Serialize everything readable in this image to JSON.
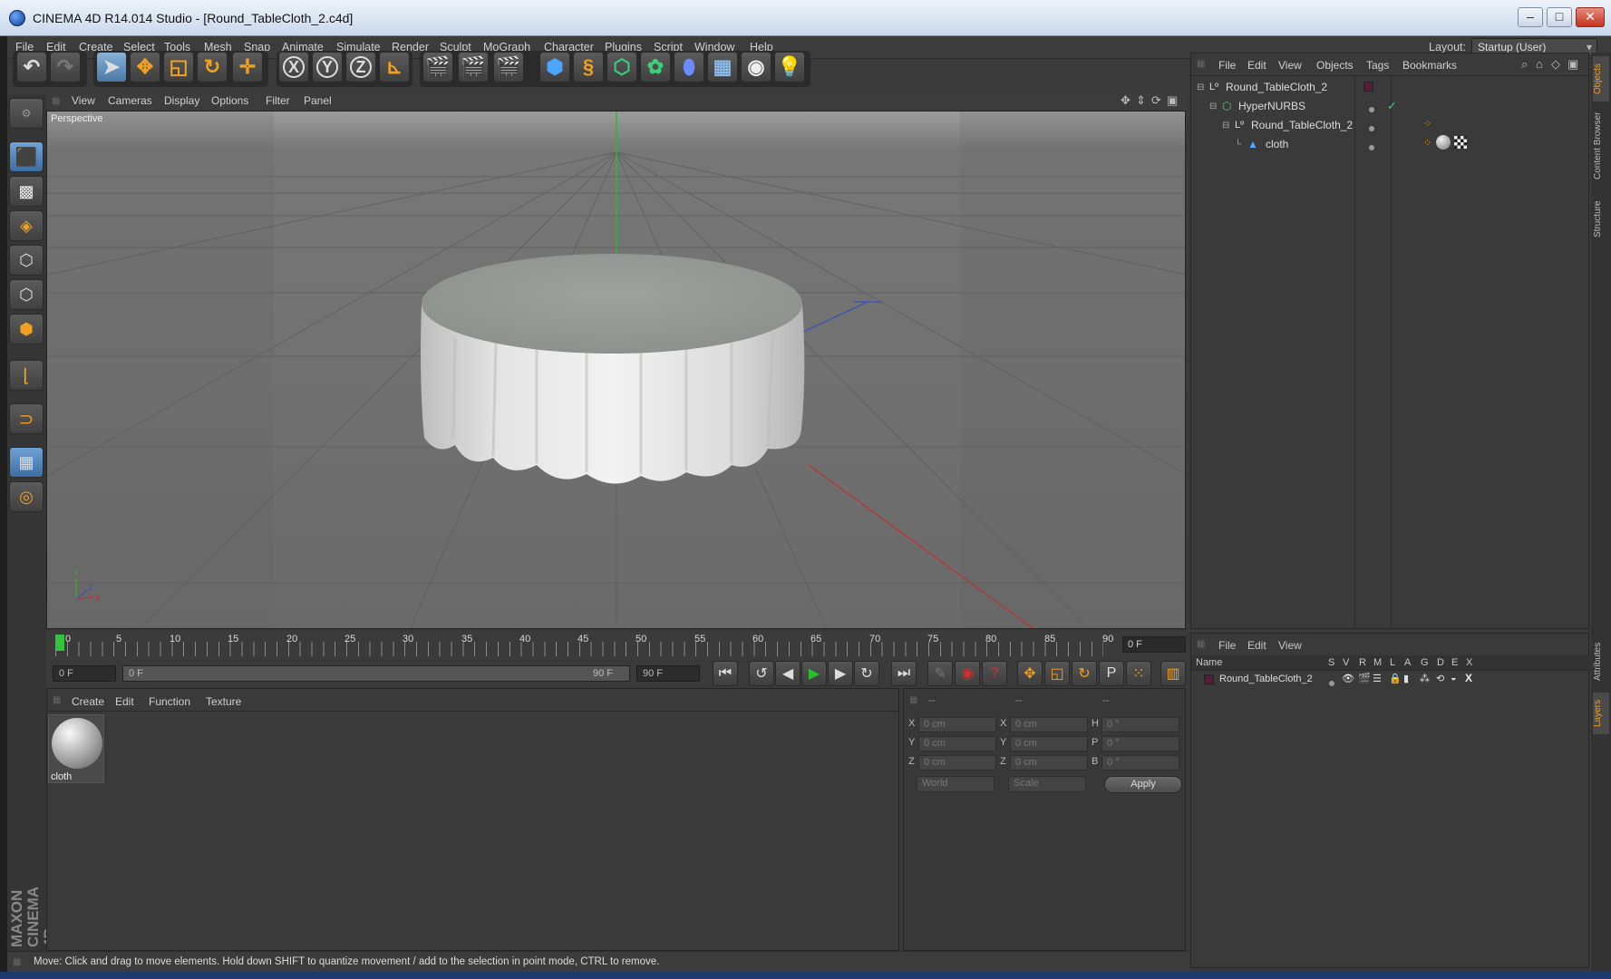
{
  "window": {
    "title": "CINEMA 4D R14.014 Studio - [Round_TableCloth_2.c4d]",
    "minimize": "–",
    "maximize": "□",
    "close": "✕"
  },
  "menubar": {
    "items": [
      "File",
      "Edit",
      "Create",
      "Select",
      "Tools",
      "Mesh",
      "Snap",
      "Animate",
      "Simulate",
      "Render",
      "Sculpt",
      "MoGraph",
      "Character",
      "Plugins",
      "Script",
      "Window",
      "Help"
    ],
    "layout_label": "Layout:",
    "layout_value": "Startup (User)"
  },
  "toolbar": {
    "axis_x": "X",
    "axis_y": "Y",
    "axis_z": "Z"
  },
  "viewport": {
    "menu": [
      "View",
      "Cameras",
      "Display",
      "Options",
      "Filter",
      "Panel"
    ],
    "label": "Perspective"
  },
  "timeline": {
    "ticks": [
      "0",
      "5",
      "10",
      "15",
      "20",
      "25",
      "30",
      "35",
      "40",
      "45",
      "50",
      "55",
      "60",
      "65",
      "70",
      "75",
      "80",
      "85",
      "90"
    ],
    "current_frame": "0 F",
    "start_frame": "0 F",
    "range_start": "0 F",
    "range_end": "90 F",
    "end_frame": "90 F"
  },
  "material_manager": {
    "menu": [
      "Create",
      "Edit",
      "Function",
      "Texture"
    ],
    "materials": [
      {
        "name": "cloth"
      }
    ]
  },
  "coordinates": {
    "headers": [
      "--",
      "--",
      "--"
    ],
    "rows": [
      {
        "a": "X",
        "av": "0 cm",
        "b": "X",
        "bv": "0 cm",
        "c": "H",
        "cv": "0 °"
      },
      {
        "a": "Y",
        "av": "0 cm",
        "b": "Y",
        "bv": "0 cm",
        "c": "P",
        "cv": "0 °"
      },
      {
        "a": "Z",
        "av": "0 cm",
        "b": "Z",
        "bv": "0 cm",
        "c": "B",
        "cv": "0 °"
      }
    ],
    "space": "World",
    "mode": "Scale",
    "apply": "Apply"
  },
  "object_manager": {
    "menu": [
      "File",
      "Edit",
      "View",
      "Objects",
      "Tags",
      "Bookmarks"
    ],
    "objects": [
      {
        "name": "Round_TableCloth_2",
        "indent": 0
      },
      {
        "name": "HyperNURBS",
        "indent": 1
      },
      {
        "name": "Round_TableCloth_2",
        "indent": 2
      },
      {
        "name": "cloth",
        "indent": 3
      }
    ]
  },
  "layer_manager": {
    "menu": [
      "File",
      "Edit",
      "View"
    ],
    "columns": [
      "Name",
      "S",
      "V",
      "R",
      "M",
      "L",
      "A",
      "G",
      "D",
      "E",
      "X"
    ],
    "layers": [
      {
        "name": "Round_TableCloth_2"
      }
    ]
  },
  "right_tabs": [
    "Objects",
    "Content Browser",
    "Structure",
    "Attributes",
    "Layers"
  ],
  "brand": "MAXON CINEMA 4D",
  "status": "Move: Click and drag to move elements. Hold down SHIFT to quantize movement / add to the selection in point mode, CTRL to remove.",
  "colors": {
    "accent_orange": "#f0a020",
    "axis_x": "#c03030",
    "axis_y": "#30a030",
    "axis_z": "#3050c0",
    "play_green": "#28c028"
  }
}
